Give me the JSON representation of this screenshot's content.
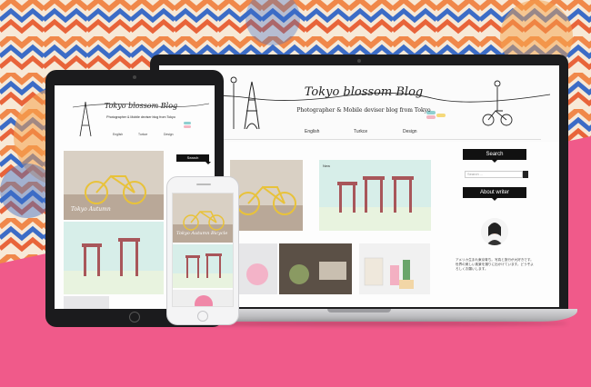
{
  "colors": {
    "background_pink": "#f05a8a",
    "pattern_orange": "#f0884a",
    "pattern_blue": "#3c6cc6",
    "device_black": "#1c1c1e",
    "device_silver": "#f4f4f5"
  },
  "laptop_blog": {
    "title": "Tokyo blossom Blog",
    "tagline": "Photographer & Mobile deviser blog from Tokyo",
    "nav": [
      "English",
      "Turkce",
      "Design"
    ],
    "sidebar": {
      "search_title": "Search",
      "search_placeholder": "Search ...",
      "about_title": "About writer",
      "about_text": "アメリカ生まれ東京育ち。写真と旅行が大好きです。世界の美しい風景を撮りに出かけています。どうぞよろしくお願いします。"
    },
    "post_badge": "New"
  },
  "tablet_blog": {
    "title": "Tokyo blossom Blog",
    "tagline": "Photographer & Mobile deviser blog from Tokyo",
    "nav": [
      "English",
      "Turkce",
      "Design"
    ],
    "post_caption": "Tokyo Autumn",
    "sidebar_label": "Search"
  },
  "phone_blog": {
    "post_caption_line1": "Tokyo Autumn Bicycle",
    "post_caption_line2": "Morning Ride Spring"
  }
}
